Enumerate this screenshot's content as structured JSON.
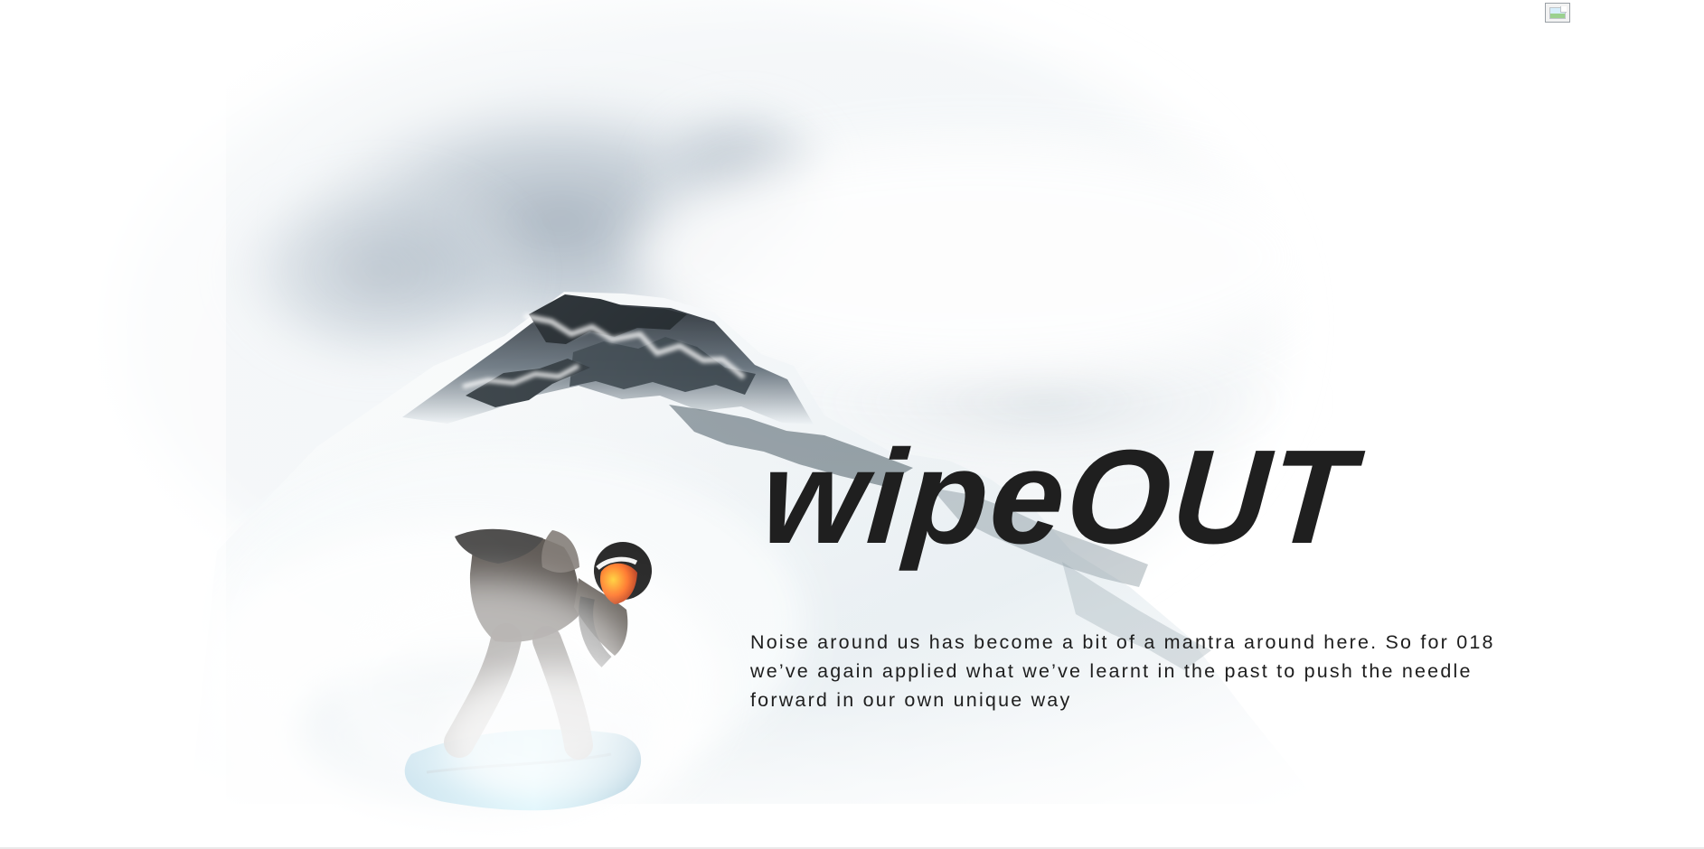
{
  "hero": {
    "headline": "wipeOUT",
    "intro": "Noise around us has become a bit of a mantra around here. So for 018 we’ve again applied what we’ve learnt in the past to push the needle forward in our own unique way",
    "headline_color": "#1f1f1f",
    "text_color": "#1e1e1e"
  },
  "icons": {
    "broken_image": "broken-image-icon"
  }
}
